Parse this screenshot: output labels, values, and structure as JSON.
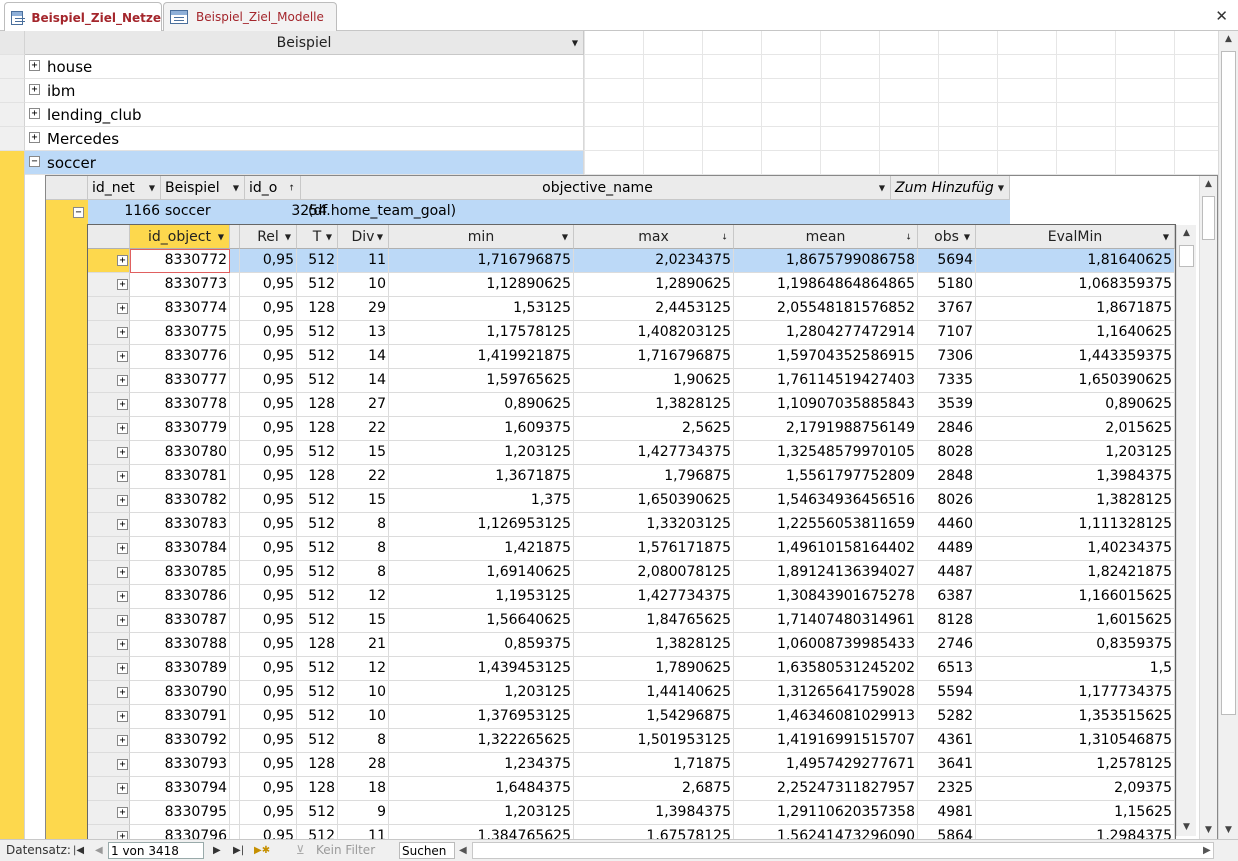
{
  "tabs": [
    {
      "label": "Beispiel_Ziel_Netze",
      "active": true
    },
    {
      "label": "Beispiel_Ziel_Modelle",
      "active": false
    }
  ],
  "close_glyph": "✕",
  "outer": {
    "header": "Beispiel",
    "rows": [
      {
        "label": "house",
        "expander": "+"
      },
      {
        "label": "ibm",
        "expander": "+"
      },
      {
        "label": "lending_club",
        "expander": "+"
      },
      {
        "label": "Mercedes",
        "expander": "+"
      },
      {
        "label": "soccer",
        "expander": "−"
      }
    ]
  },
  "sub1": {
    "headers": [
      "id_net",
      "Beispiel",
      "id_o",
      "objective_name",
      "Zum Hinzufüg"
    ],
    "row": {
      "id_net": "1166",
      "beispiel": "soccer",
      "id_o": "3254",
      "objective_name": "(df.home_team_goal)",
      "expander": "−"
    }
  },
  "sub2": {
    "headers": [
      "id_object",
      "Rel",
      "T",
      "Div",
      "min",
      "max",
      "mean",
      "obs",
      "EvalMin"
    ],
    "rows": [
      [
        "8330772",
        "0,95",
        "512",
        "11",
        "1,716796875",
        "2,0234375",
        "1,8675799086758",
        "5694",
        "1,81640625"
      ],
      [
        "8330773",
        "0,95",
        "512",
        "10",
        "1,12890625",
        "1,2890625",
        "1,19864864864865",
        "5180",
        "1,068359375"
      ],
      [
        "8330774",
        "0,95",
        "128",
        "29",
        "1,53125",
        "2,4453125",
        "2,05548181576852",
        "3767",
        "1,8671875"
      ],
      [
        "8330775",
        "0,95",
        "512",
        "13",
        "1,17578125",
        "1,408203125",
        "1,2804277472914",
        "7107",
        "1,1640625"
      ],
      [
        "8330776",
        "0,95",
        "512",
        "14",
        "1,419921875",
        "1,716796875",
        "1,59704352586915",
        "7306",
        "1,443359375"
      ],
      [
        "8330777",
        "0,95",
        "512",
        "14",
        "1,59765625",
        "1,90625",
        "1,76114519427403",
        "7335",
        "1,650390625"
      ],
      [
        "8330778",
        "0,95",
        "128",
        "27",
        "0,890625",
        "1,3828125",
        "1,10907035885843",
        "3539",
        "0,890625"
      ],
      [
        "8330779",
        "0,95",
        "128",
        "22",
        "1,609375",
        "2,5625",
        "2,1791988756149",
        "2846",
        "2,015625"
      ],
      [
        "8330780",
        "0,95",
        "512",
        "15",
        "1,203125",
        "1,427734375",
        "1,32548579970105",
        "8028",
        "1,203125"
      ],
      [
        "8330781",
        "0,95",
        "128",
        "22",
        "1,3671875",
        "1,796875",
        "1,5561797752809",
        "2848",
        "1,3984375"
      ],
      [
        "8330782",
        "0,95",
        "512",
        "15",
        "1,375",
        "1,650390625",
        "1,54634936456516",
        "8026",
        "1,3828125"
      ],
      [
        "8330783",
        "0,95",
        "512",
        "8",
        "1,126953125",
        "1,33203125",
        "1,22556053811659",
        "4460",
        "1,111328125"
      ],
      [
        "8330784",
        "0,95",
        "512",
        "8",
        "1,421875",
        "1,576171875",
        "1,49610158164402",
        "4489",
        "1,40234375"
      ],
      [
        "8330785",
        "0,95",
        "512",
        "8",
        "1,69140625",
        "2,080078125",
        "1,89124136394027",
        "4487",
        "1,82421875"
      ],
      [
        "8330786",
        "0,95",
        "512",
        "12",
        "1,1953125",
        "1,427734375",
        "1,30843901675278",
        "6387",
        "1,166015625"
      ],
      [
        "8330787",
        "0,95",
        "512",
        "15",
        "1,56640625",
        "1,84765625",
        "1,71407480314961",
        "8128",
        "1,6015625"
      ],
      [
        "8330788",
        "0,95",
        "128",
        "21",
        "0,859375",
        "1,3828125",
        "1,06008739985433",
        "2746",
        "0,8359375"
      ],
      [
        "8330789",
        "0,95",
        "512",
        "12",
        "1,439453125",
        "1,7890625",
        "1,63580531245202",
        "6513",
        "1,5"
      ],
      [
        "8330790",
        "0,95",
        "512",
        "10",
        "1,203125",
        "1,44140625",
        "1,31265641759028",
        "5594",
        "1,177734375"
      ],
      [
        "8330791",
        "0,95",
        "512",
        "10",
        "1,376953125",
        "1,54296875",
        "1,46346081029913",
        "5282",
        "1,353515625"
      ],
      [
        "8330792",
        "0,95",
        "512",
        "8",
        "1,322265625",
        "1,501953125",
        "1,41916991515707",
        "4361",
        "1,310546875"
      ],
      [
        "8330793",
        "0,95",
        "128",
        "28",
        "1,234375",
        "1,71875",
        "1,4957429277671",
        "3641",
        "1,2578125"
      ],
      [
        "8330794",
        "0,95",
        "128",
        "18",
        "1,6484375",
        "2,6875",
        "2,25247311827957",
        "2325",
        "2,09375"
      ],
      [
        "8330795",
        "0,95",
        "512",
        "9",
        "1,203125",
        "1,3984375",
        "1,29110620357358",
        "4981",
        "1,15625"
      ],
      [
        "8330796",
        "0,95",
        "512",
        "11",
        "1,384765625",
        "1,67578125",
        "1,56241473296090",
        "5864",
        "1,2984375"
      ]
    ]
  },
  "nav": {
    "label": "Datensatz:",
    "position": "1 von 3418",
    "filter": "Kein Filter",
    "search_placeholder": "Suchen"
  }
}
